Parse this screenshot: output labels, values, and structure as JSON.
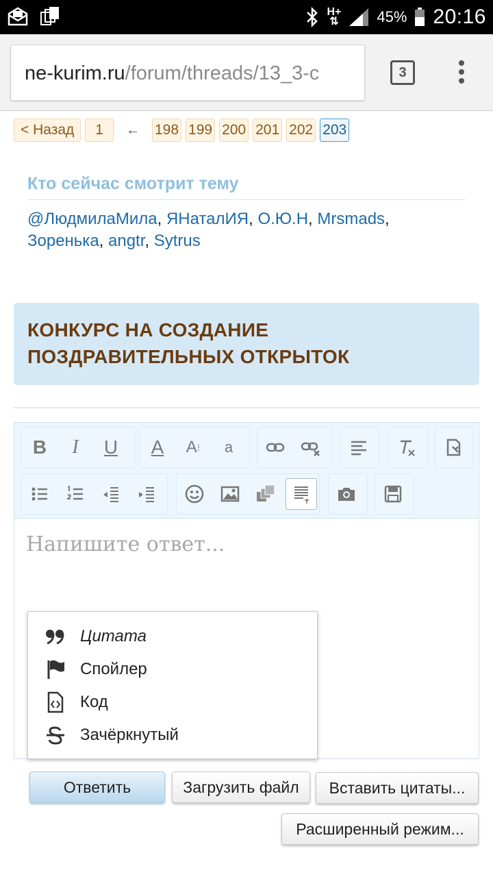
{
  "status_bar": {
    "network_label": "H+",
    "battery": "45%",
    "time": "20:16"
  },
  "browser": {
    "url_host": "ne-kurim.ru",
    "url_path": "/forum/threads/13_3-c",
    "tab_count": "3"
  },
  "pagination": {
    "back_label": "< Назад",
    "first_page": "1",
    "ellipsis_arrow": "←",
    "pages": [
      "198",
      "199",
      "200",
      "201",
      "202",
      "203"
    ],
    "current_page": "203"
  },
  "viewers": {
    "title": "Кто сейчас смотрит тему",
    "users": [
      "@ЛюдмилаМила",
      "ЯНаталИЯ",
      "О.Ю.Н",
      "Mrsmads",
      "Зоренька",
      "angtr",
      "Sytrus"
    ]
  },
  "thread": {
    "title_line1": "КОНКУРС НА СОЗДАНИЕ",
    "title_line2": "ПОЗДРАВИТЕЛЬНЫХ ОТКРЫТОК"
  },
  "editor": {
    "placeholder": "Напишите ответ...",
    "toolbar_icons": [
      "bold-icon",
      "italic-icon",
      "underline-icon",
      "font-color-icon",
      "font-size-icon",
      "font-family-icon",
      "link-icon",
      "unlink-icon",
      "align-icon",
      "remove-format-icon",
      "paste-icon",
      "bullet-list-icon",
      "numbered-list-icon",
      "outdent-icon",
      "indent-icon",
      "smiley-icon",
      "image-icon",
      "media-icon",
      "bbcode-menu-icon",
      "camera-icon",
      "save-draft-icon"
    ],
    "toolbar_text": {
      "bold": "B",
      "italic": "I",
      "underline": "U",
      "font_color": "A",
      "font_size": "A",
      "font_family": "a"
    }
  },
  "dropdown": {
    "items": [
      {
        "label": "Цитата",
        "icon": "quote-icon"
      },
      {
        "label": "Спойлер",
        "icon": "flag-icon"
      },
      {
        "label": "Код",
        "icon": "code-file-icon"
      },
      {
        "label": "Зачёркнутый",
        "icon": "strikethrough-icon"
      }
    ]
  },
  "buttons": {
    "reply": "Ответить",
    "upload": "Загрузить файл",
    "insert_quotes": "Вставить цитаты...",
    "advanced": "Расширенный режим..."
  },
  "colors": {
    "link": "#1f6ba6",
    "banner_bg": "#d5e8f6",
    "banner_text": "#6b3c10",
    "page_bg": "#fff4e2",
    "toolbar_bg": "#edf6fc"
  }
}
